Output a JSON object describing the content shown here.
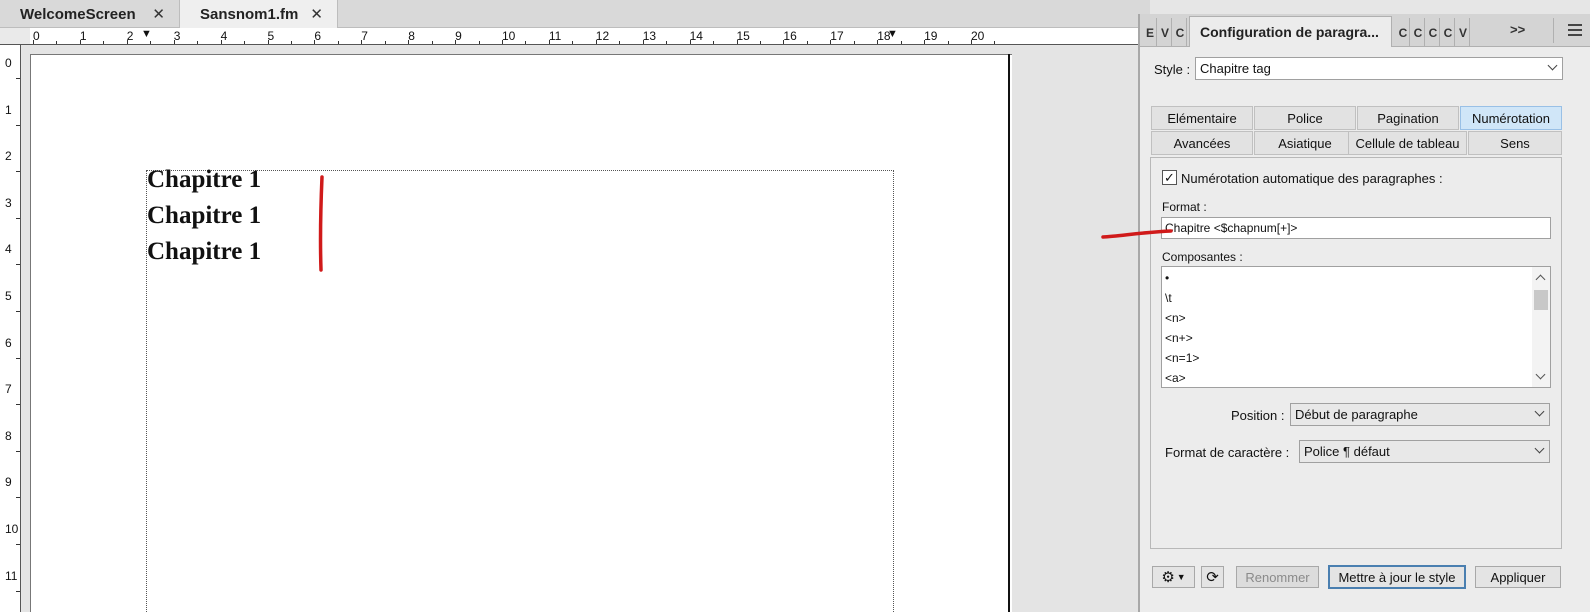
{
  "document_tabs": [
    {
      "label": "WelcomeScreen",
      "close": "✕"
    },
    {
      "label": "Sansnom1.fm",
      "close": "✕"
    }
  ],
  "ruler": {
    "horizontal": [
      "0",
      "1",
      "2",
      "3",
      "4",
      "5",
      "6",
      "7",
      "8",
      "9",
      "10",
      "11",
      "12",
      "13",
      "14",
      "15",
      "16",
      "17",
      "18",
      "19",
      "20"
    ],
    "vertical": [
      "0",
      "1",
      "2",
      "3",
      "4",
      "5",
      "6",
      "7",
      "8",
      "9",
      "10",
      "11"
    ]
  },
  "page": {
    "lines": [
      "Chapitre 1",
      "Chapitre 1",
      "Chapitre 1"
    ]
  },
  "colors": {
    "annotation": "#d01a1a",
    "active_tab": "#d0e6f8"
  },
  "panel": {
    "collapsed_tabs": [
      "E",
      "V",
      "C",
      "C",
      "C",
      "C",
      "C",
      "V"
    ],
    "title": "Configuration de paragra...",
    "overflow": ">>",
    "style_label": "Style :",
    "style_value": "Chapitre tag",
    "subtabs_row1": [
      "Elémentaire",
      "Police",
      "Pagination",
      "Numérotation"
    ],
    "subtabs_row2": [
      "Avancées",
      "Asiatique",
      "Cellule de tableau",
      "Sens"
    ],
    "active_subtab": "Numérotation",
    "auto_numbering_label": "Numérotation automatique des paragraphes :",
    "auto_numbering_checked": true,
    "format_label": "Format :",
    "format_value": "Chapitre <$chapnum[+]>",
    "components_label": "Composantes :",
    "components": [
      "•",
      "\\t",
      "<n>",
      "<n+>",
      "<n=1>",
      "<a>"
    ],
    "position_label": "Position :",
    "position_value": "Début de paragraphe",
    "char_format_label": "Format de caractère :",
    "char_format_value": "Police ¶ défaut",
    "rename_label": "Renommer",
    "update_label": "Mettre à jour le style",
    "apply_label": "Appliquer"
  }
}
